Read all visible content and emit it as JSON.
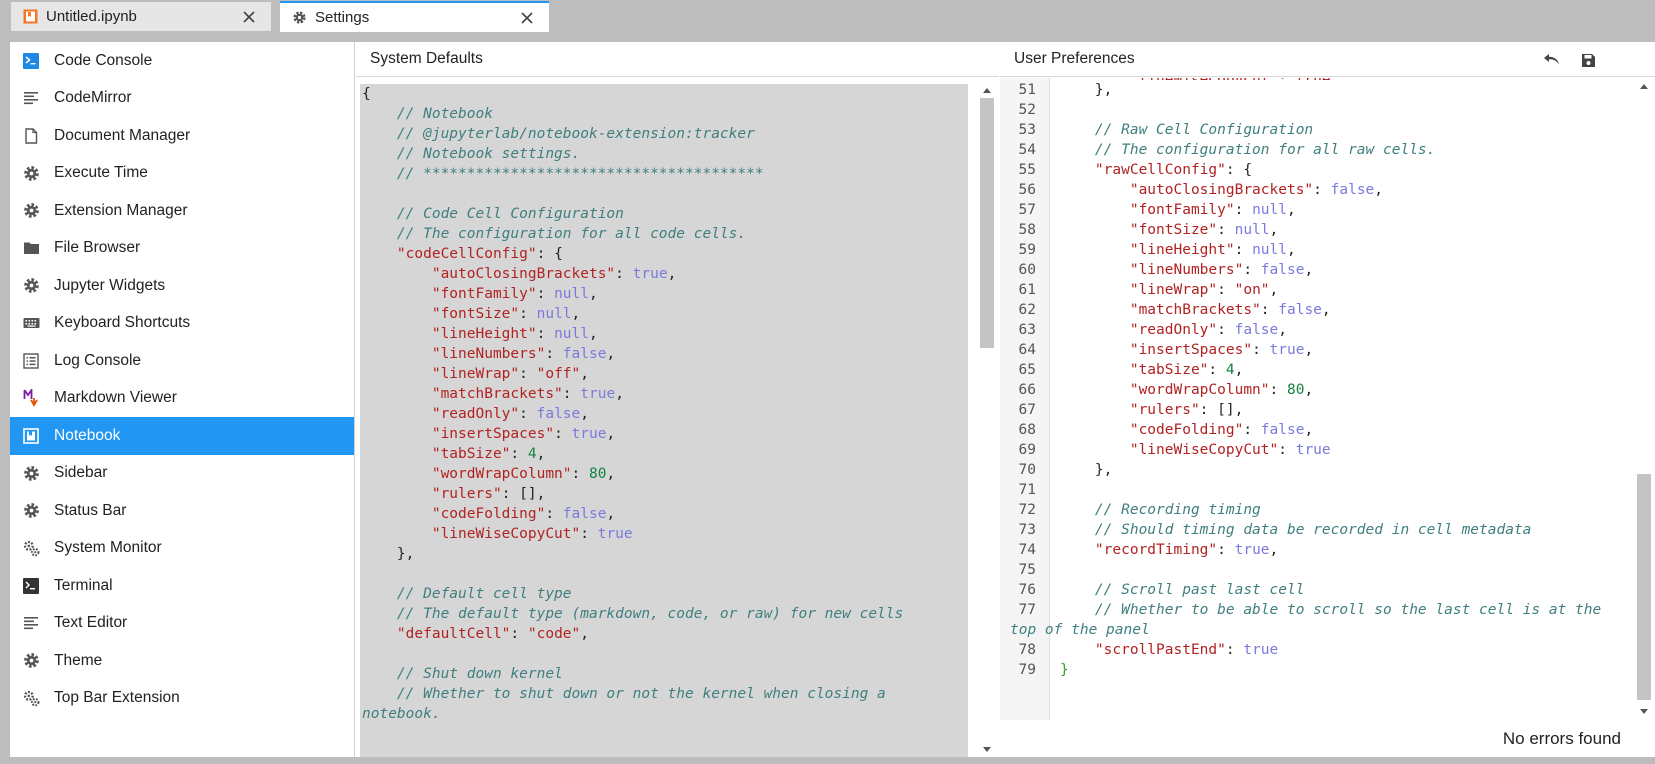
{
  "tabs": [
    {
      "label": "Untitled.ipynb",
      "icon": "notebook-icon"
    },
    {
      "label": "Settings",
      "icon": "gear-icon"
    }
  ],
  "sidebar": {
    "items": [
      {
        "label": "Code Console",
        "icon": "console-icon"
      },
      {
        "label": "CodeMirror",
        "icon": "text-lines-icon"
      },
      {
        "label": "Document Manager",
        "icon": "file-icon"
      },
      {
        "label": "Execute Time",
        "icon": "gear-icon"
      },
      {
        "label": "Extension Manager",
        "icon": "gear-icon"
      },
      {
        "label": "File Browser",
        "icon": "folder-icon"
      },
      {
        "label": "Jupyter Widgets",
        "icon": "gear-icon"
      },
      {
        "label": "Keyboard Shortcuts",
        "icon": "keyboard-icon"
      },
      {
        "label": "Log Console",
        "icon": "list-icon"
      },
      {
        "label": "Markdown Viewer",
        "icon": "markdown-icon"
      },
      {
        "label": "Notebook",
        "icon": "notebook-icon"
      },
      {
        "label": "Sidebar",
        "icon": "gear-icon"
      },
      {
        "label": "Status Bar",
        "icon": "gear-icon"
      },
      {
        "label": "System Monitor",
        "icon": "gears-icon"
      },
      {
        "label": "Terminal",
        "icon": "terminal-icon"
      },
      {
        "label": "Text Editor",
        "icon": "text-lines-icon"
      },
      {
        "label": "Theme",
        "icon": "gear-icon"
      },
      {
        "label": "Top Bar Extension",
        "icon": "gears-icon"
      }
    ],
    "active_index": 10
  },
  "system_defaults": {
    "title": "System Defaults",
    "lines": [
      [
        [
          "{",
          "pun"
        ]
      ],
      [
        [
          "    // Notebook",
          "com"
        ]
      ],
      [
        [
          "    // @jupyterlab/notebook-extension:tracker",
          "com"
        ]
      ],
      [
        [
          "    // Notebook settings.",
          "com"
        ]
      ],
      [
        [
          "    // ***************************************",
          "com"
        ]
      ],
      [],
      [
        [
          "    // Code Cell Configuration",
          "com"
        ]
      ],
      [
        [
          "    // The configuration for all code cells.",
          "com"
        ]
      ],
      [
        [
          "    \"codeCellConfig\"",
          "str"
        ],
        [
          ": {",
          "pun"
        ]
      ],
      [
        [
          "        \"autoClosingBrackets\"",
          "str"
        ],
        [
          ": ",
          "pun"
        ],
        [
          "true",
          "kw"
        ],
        [
          ",",
          "pun"
        ]
      ],
      [
        [
          "        \"fontFamily\"",
          "str"
        ],
        [
          ": ",
          "pun"
        ],
        [
          "null",
          "kw"
        ],
        [
          ",",
          "pun"
        ]
      ],
      [
        [
          "        \"fontSize\"",
          "str"
        ],
        [
          ": ",
          "pun"
        ],
        [
          "null",
          "kw"
        ],
        [
          ",",
          "pun"
        ]
      ],
      [
        [
          "        \"lineHeight\"",
          "str"
        ],
        [
          ": ",
          "pun"
        ],
        [
          "null",
          "kw"
        ],
        [
          ",",
          "pun"
        ]
      ],
      [
        [
          "        \"lineNumbers\"",
          "str"
        ],
        [
          ": ",
          "pun"
        ],
        [
          "false",
          "kw"
        ],
        [
          ",",
          "pun"
        ]
      ],
      [
        [
          "        \"lineWrap\"",
          "str"
        ],
        [
          ": ",
          "pun"
        ],
        [
          "\"off\"",
          "str"
        ],
        [
          ",",
          "pun"
        ]
      ],
      [
        [
          "        \"matchBrackets\"",
          "str"
        ],
        [
          ": ",
          "pun"
        ],
        [
          "true",
          "kw"
        ],
        [
          ",",
          "pun"
        ]
      ],
      [
        [
          "        \"readOnly\"",
          "str"
        ],
        [
          ": ",
          "pun"
        ],
        [
          "false",
          "kw"
        ],
        [
          ",",
          "pun"
        ]
      ],
      [
        [
          "        \"insertSpaces\"",
          "str"
        ],
        [
          ": ",
          "pun"
        ],
        [
          "true",
          "kw"
        ],
        [
          ",",
          "pun"
        ]
      ],
      [
        [
          "        \"tabSize\"",
          "str"
        ],
        [
          ": ",
          "pun"
        ],
        [
          "4",
          "num"
        ],
        [
          ",",
          "pun"
        ]
      ],
      [
        [
          "        \"wordWrapColumn\"",
          "str"
        ],
        [
          ": ",
          "pun"
        ],
        [
          "80",
          "num"
        ],
        [
          ",",
          "pun"
        ]
      ],
      [
        [
          "        \"rulers\"",
          "str"
        ],
        [
          ": [],",
          "pun"
        ]
      ],
      [
        [
          "        \"codeFolding\"",
          "str"
        ],
        [
          ": ",
          "pun"
        ],
        [
          "false",
          "kw"
        ],
        [
          ",",
          "pun"
        ]
      ],
      [
        [
          "        \"lineWiseCopyCut\"",
          "str"
        ],
        [
          ": ",
          "pun"
        ],
        [
          "true",
          "kw"
        ]
      ],
      [
        [
          "    },",
          "pun"
        ]
      ],
      [],
      [
        [
          "    // Default cell type",
          "com"
        ]
      ],
      [
        [
          "    // The default type (markdown, code, or raw) for new cells",
          "com"
        ]
      ],
      [
        [
          "    \"defaultCell\"",
          "str"
        ],
        [
          ": ",
          "pun"
        ],
        [
          "\"code\"",
          "str"
        ],
        [
          ",",
          "pun"
        ]
      ],
      [],
      [
        [
          "    // Shut down kernel",
          "com"
        ]
      ],
      [
        [
          "    // Whether to shut down or not the kernel when closing a",
          "com"
        ]
      ],
      [
        [
          "notebook.",
          "com"
        ]
      ]
    ]
  },
  "user_preferences": {
    "title": "User Preferences",
    "status": "No errors found",
    "lines": [
      {
        "n": "",
        "parts": [
          [
            "        \"lineWiseCopyCut\": true",
            "str"
          ]
        ]
      },
      {
        "n": "51",
        "parts": [
          [
            "    },",
            "pun"
          ]
        ]
      },
      {
        "n": "52",
        "parts": []
      },
      {
        "n": "53",
        "parts": [
          [
            "    // Raw Cell Configuration",
            "com"
          ]
        ]
      },
      {
        "n": "54",
        "parts": [
          [
            "    // The configuration for all raw cells.",
            "com"
          ]
        ]
      },
      {
        "n": "55",
        "parts": [
          [
            "    \"rawCellConfig\"",
            "str"
          ],
          [
            ": {",
            "pun"
          ]
        ]
      },
      {
        "n": "56",
        "parts": [
          [
            "        \"autoClosingBrackets\"",
            "str"
          ],
          [
            ": ",
            "pun"
          ],
          [
            "false",
            "kw"
          ],
          [
            ",",
            "pun"
          ]
        ]
      },
      {
        "n": "57",
        "parts": [
          [
            "        \"fontFamily\"",
            "str"
          ],
          [
            ": ",
            "pun"
          ],
          [
            "null",
            "kw"
          ],
          [
            ",",
            "pun"
          ]
        ]
      },
      {
        "n": "58",
        "parts": [
          [
            "        \"fontSize\"",
            "str"
          ],
          [
            ": ",
            "pun"
          ],
          [
            "null",
            "kw"
          ],
          [
            ",",
            "pun"
          ]
        ]
      },
      {
        "n": "59",
        "parts": [
          [
            "        \"lineHeight\"",
            "str"
          ],
          [
            ": ",
            "pun"
          ],
          [
            "null",
            "kw"
          ],
          [
            ",",
            "pun"
          ]
        ]
      },
      {
        "n": "60",
        "parts": [
          [
            "        \"lineNumbers\"",
            "str"
          ],
          [
            ": ",
            "pun"
          ],
          [
            "false",
            "kw"
          ],
          [
            ",",
            "pun"
          ]
        ]
      },
      {
        "n": "61",
        "parts": [
          [
            "        \"lineWrap\"",
            "str"
          ],
          [
            ": ",
            "pun"
          ],
          [
            "\"on\"",
            "str"
          ],
          [
            ",",
            "pun"
          ]
        ]
      },
      {
        "n": "62",
        "parts": [
          [
            "        \"matchBrackets\"",
            "str"
          ],
          [
            ": ",
            "pun"
          ],
          [
            "false",
            "kw"
          ],
          [
            ",",
            "pun"
          ]
        ]
      },
      {
        "n": "63",
        "parts": [
          [
            "        \"readOnly\"",
            "str"
          ],
          [
            ": ",
            "pun"
          ],
          [
            "false",
            "kw"
          ],
          [
            ",",
            "pun"
          ]
        ]
      },
      {
        "n": "64",
        "parts": [
          [
            "        \"insertSpaces\"",
            "str"
          ],
          [
            ": ",
            "pun"
          ],
          [
            "true",
            "kw"
          ],
          [
            ",",
            "pun"
          ]
        ]
      },
      {
        "n": "65",
        "parts": [
          [
            "        \"tabSize\"",
            "str"
          ],
          [
            ": ",
            "pun"
          ],
          [
            "4",
            "num"
          ],
          [
            ",",
            "pun"
          ]
        ]
      },
      {
        "n": "66",
        "parts": [
          [
            "        \"wordWrapColumn\"",
            "str"
          ],
          [
            ": ",
            "pun"
          ],
          [
            "80",
            "num"
          ],
          [
            ",",
            "pun"
          ]
        ]
      },
      {
        "n": "67",
        "parts": [
          [
            "        \"rulers\"",
            "str"
          ],
          [
            ": [],",
            "pun"
          ]
        ]
      },
      {
        "n": "68",
        "parts": [
          [
            "        \"codeFolding\"",
            "str"
          ],
          [
            ": ",
            "pun"
          ],
          [
            "false",
            "kw"
          ],
          [
            ",",
            "pun"
          ]
        ]
      },
      {
        "n": "69",
        "parts": [
          [
            "        \"lineWiseCopyCut\"",
            "str"
          ],
          [
            ": ",
            "pun"
          ],
          [
            "true",
            "kw"
          ]
        ]
      },
      {
        "n": "70",
        "parts": [
          [
            "    },",
            "pun"
          ]
        ]
      },
      {
        "n": "71",
        "parts": []
      },
      {
        "n": "72",
        "parts": [
          [
            "    // Recording timing",
            "com"
          ]
        ]
      },
      {
        "n": "73",
        "parts": [
          [
            "    // Should timing data be recorded in cell metadata",
            "com"
          ]
        ]
      },
      {
        "n": "74",
        "parts": [
          [
            "    \"recordTiming\"",
            "str"
          ],
          [
            ": ",
            "pun"
          ],
          [
            "true",
            "kw"
          ],
          [
            ",",
            "pun"
          ]
        ]
      },
      {
        "n": "75",
        "parts": []
      },
      {
        "n": "76",
        "parts": [
          [
            "    // Scroll past last cell",
            "com"
          ]
        ]
      },
      {
        "n": "77",
        "parts": [
          [
            "    // Whether to be able to scroll so the last cell is at the",
            "com"
          ]
        ]
      },
      {
        "n": "",
        "parts": [
          [
            "top of the panel",
            "com"
          ]
        ]
      },
      {
        "n": "78",
        "parts": [
          [
            "    \"scrollPastEnd\"",
            "str"
          ],
          [
            ": ",
            "pun"
          ],
          [
            "true",
            "kw"
          ]
        ]
      },
      {
        "n": "79",
        "parts": [
          [
            "}",
            "br"
          ]
        ]
      }
    ]
  },
  "colors": {
    "accent": "#2196f3",
    "comment": "#3f7f7f",
    "string": "#b22222",
    "keyword": "#7a7adc",
    "number": "#11843d"
  }
}
